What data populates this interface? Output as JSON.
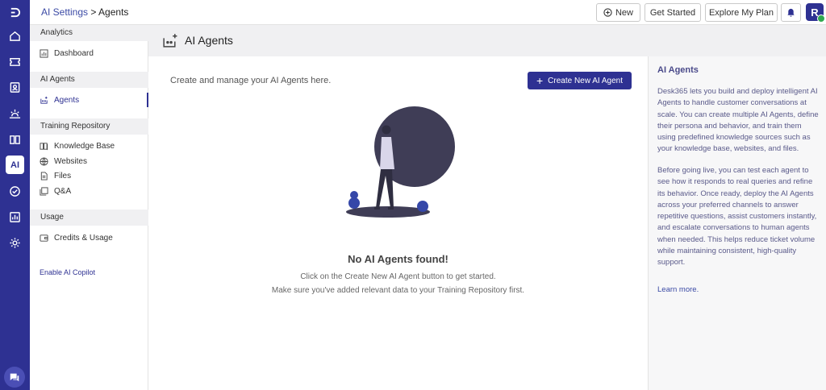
{
  "rail": {
    "ai_label": "AI"
  },
  "topbar": {
    "breadcrumb_root": "AI Settings",
    "breadcrumb_sep": " > ",
    "breadcrumb_current": "Agents",
    "new_label": "New",
    "get_started_label": "Get Started",
    "explore_label": "Explore My Plan",
    "avatar_initial": "R"
  },
  "sidebar": {
    "sections": [
      {
        "title": "Analytics",
        "items": [
          {
            "label": "Dashboard",
            "icon": "chart-icon"
          }
        ]
      },
      {
        "title": "AI Agents",
        "items": [
          {
            "label": "Agents",
            "icon": "agent-icon"
          }
        ]
      },
      {
        "title": "Training Repository",
        "items": [
          {
            "label": "Knowledge Base",
            "icon": "book-icon"
          },
          {
            "label": "Websites",
            "icon": "globe-icon"
          },
          {
            "label": "Files",
            "icon": "file-icon"
          },
          {
            "label": "Q&A",
            "icon": "qa-icon"
          }
        ]
      },
      {
        "title": "Usage",
        "items": [
          {
            "label": "Credits & Usage",
            "icon": "wallet-icon"
          }
        ]
      }
    ],
    "active_item": "Agents",
    "copilot_label": "Enable AI Copilot"
  },
  "main": {
    "title": "AI Agents",
    "intro": "Create and manage your AI Agents here.",
    "create_label": "Create New AI Agent",
    "empty_title": "No AI Agents found!",
    "empty_line1": "Click on the Create New AI Agent button to get started.",
    "empty_line2": "Make sure you've added relevant data to your Training Repository first."
  },
  "info": {
    "title": "AI Agents",
    "p1": "Desk365 lets you build and deploy intelligent AI Agents to handle customer conversations at scale. You can create multiple AI Agents, define their persona and behavior, and train them using predefined knowledge sources such as your knowledge base, websites, and files.",
    "p2": "Before going live, you can test each agent to see how it responds to real queries and refine its behavior. Once ready, deploy the AI Agents across your preferred channels to answer repetitive questions, assist customers instantly, and escalate conversations to human agents when needed. This helps reduce ticket volume while maintaining consistent, high-quality support.",
    "learn_more": "Learn more."
  },
  "colors": {
    "brand": "#2e3192",
    "status_online": "#2fa84f"
  }
}
